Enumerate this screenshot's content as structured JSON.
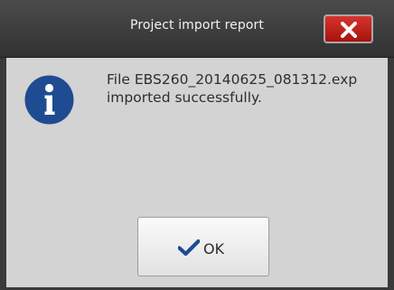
{
  "dialog": {
    "title": "Project import report",
    "message_line1": "File EBS260_20140625_081312.exp",
    "message_line2": "imported successfully.",
    "ok_label": "OK"
  },
  "icons": {
    "close": "close-icon",
    "info": "info-icon",
    "check": "checkmark-icon"
  },
  "colors": {
    "titlebar": "#3b3b3b",
    "close_button": "#c4201a",
    "info_circle": "#1f4b92",
    "check": "#1f4b92",
    "background": "#d3d3d3"
  }
}
